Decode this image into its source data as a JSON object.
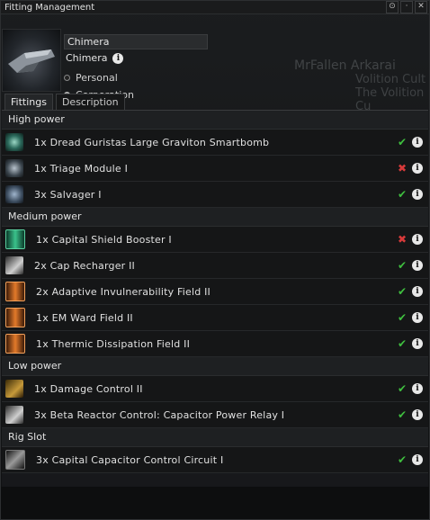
{
  "window": {
    "title": "Fitting Management",
    "controls": [
      "⊙",
      "·",
      "✕"
    ]
  },
  "header": {
    "name_value": "Chimera",
    "ship_type": "Chimera",
    "radio_personal": "Personal",
    "radio_corporation": "Corporation"
  },
  "background_char": {
    "name": "MrFallen Arkarai",
    "corp": "Volition Cult",
    "alliance": "The Volition Cu"
  },
  "tabs": [
    "Fittings",
    "Description"
  ],
  "sections": [
    {
      "title": "High power",
      "items": [
        {
          "label": "1x Dread Guristas Large Graviton Smartbomb",
          "status": "ok",
          "icon": "smartbomb-icon"
        },
        {
          "label": "1x Triage Module I",
          "status": "bad",
          "icon": "triage-icon"
        },
        {
          "label": "3x Salvager I",
          "status": "ok",
          "icon": "salvager-icon"
        }
      ]
    },
    {
      "title": "Medium power",
      "items": [
        {
          "label": "1x Capital Shield Booster I",
          "status": "bad",
          "icon": "shield-booster-icon"
        },
        {
          "label": "2x Cap Recharger II",
          "status": "ok",
          "icon": "cap-recharger-icon"
        },
        {
          "label": "2x Adaptive Invulnerability Field II",
          "status": "ok",
          "icon": "invuln-field-icon"
        },
        {
          "label": "1x EM Ward Field II",
          "status": "ok",
          "icon": "em-ward-icon"
        },
        {
          "label": "1x Thermic Dissipation Field II",
          "status": "ok",
          "icon": "thermic-field-icon"
        }
      ]
    },
    {
      "title": "Low power",
      "items": [
        {
          "label": "1x Damage Control II",
          "status": "ok",
          "icon": "damage-control-icon"
        },
        {
          "label": "3x Beta Reactor Control: Capacitor Power Relay I",
          "status": "ok",
          "icon": "power-relay-icon"
        }
      ]
    },
    {
      "title": "Rig Slot",
      "items": [
        {
          "label": "3x Capital Capacitor Control Circuit I",
          "status": "ok",
          "icon": "rig-icon"
        }
      ]
    }
  ],
  "glyphs": {
    "ok": "✔",
    "bad": "✖",
    "info": "i"
  },
  "colors": {
    "ok": "#3fbf3f",
    "bad": "#d83a3a"
  }
}
